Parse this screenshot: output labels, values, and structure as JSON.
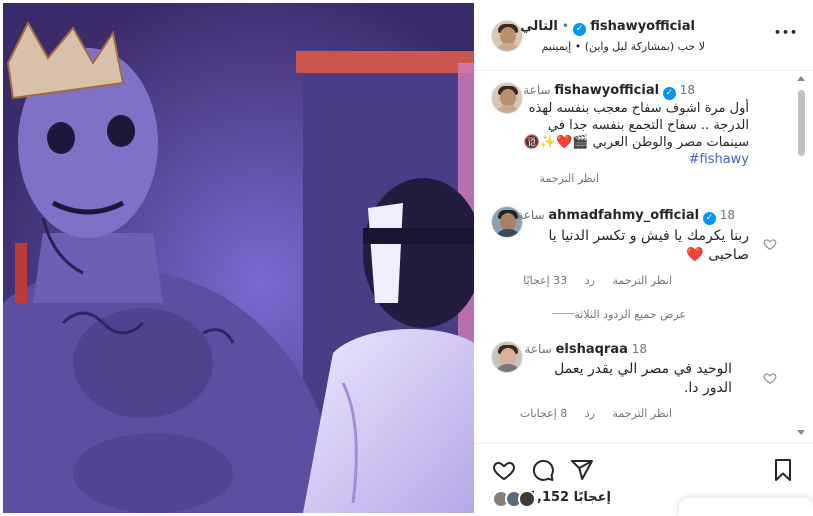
{
  "post": {
    "author_username": "fishawyofficial",
    "follow_separator": "•",
    "follow_label": "التالي",
    "audio_line": "لا حب (بمشاركة ليل واين) • إيمينيم",
    "more_label": "•••"
  },
  "caption": {
    "username": "fishawyofficial",
    "time": "18 ساعة",
    "text_line1": "أول مرة اشوف سفاح معجب بنفسه لهذه",
    "text_line2": "الدرجة .. سفاح التجمع بنفسه جدا في",
    "text_line3": "سينمات مصر والوطن العربي 🎬❤️✨🔞",
    "hashtag": "#fishawy",
    "translate": "انظر الترجمة"
  },
  "comments": [
    {
      "username": "ahmadfahmy_official",
      "verified": true,
      "time": "18 ساعة",
      "text_line1": "ربنا يكرمك يا فيش و تكسر الدنيا يا",
      "text_line2": "صاحبى ❤️",
      "translate": "انظر الترجمة",
      "reply": "رد",
      "likes": "33 إعجابًا"
    },
    {
      "username": "elshaqraa",
      "verified": false,
      "time": "18 ساعة",
      "text_line1": "الوحيد في مصر الي يقدر يعمل",
      "text_line2": "الدور دا.",
      "translate": "انظر الترجمة",
      "reply": "رد",
      "likes": "8 إعجابات"
    }
  ],
  "view_replies": "عرض جميع الردود الثلاثة",
  "footer": {
    "likes_count": "1,152",
    "likes_word": "إعجابًا"
  },
  "icons": {
    "heart": "heart-icon",
    "comment": "comment-icon",
    "share": "share-icon",
    "save": "bookmark-icon",
    "verified": "verified-badge-icon"
  },
  "colors": {
    "verified": "#0095f6",
    "link": "#00376b",
    "hashtag": "#4a5ec9",
    "muted": "#737373"
  }
}
